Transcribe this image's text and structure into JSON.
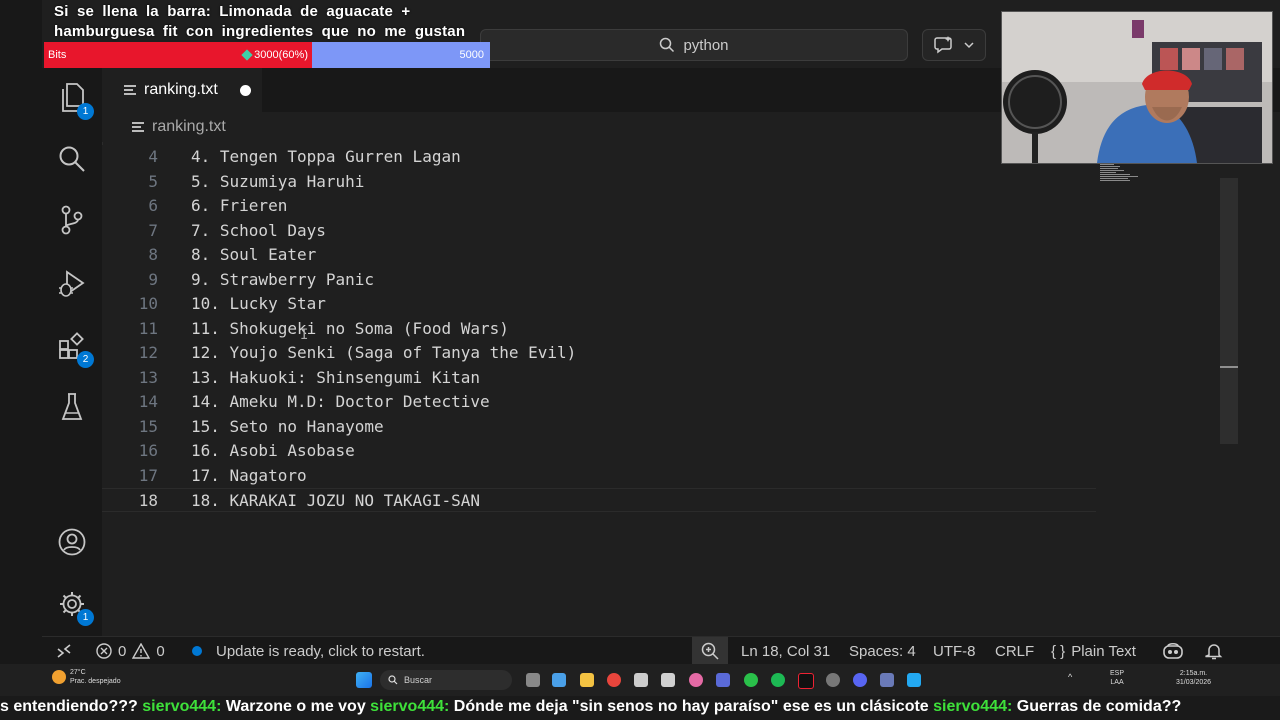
{
  "overlay": {
    "goal_text": "Si se llena la barra: Limonada de aguacate + hamburguesa fit con ingredientes que no me gustan",
    "bits_label": "Bits",
    "bits_progress_label": "3000(60%)",
    "bits_goal": "5000",
    "bits_fraction": 0.6
  },
  "titlebar": {
    "search_text": "python"
  },
  "activity_bar": {
    "explorer_badge": "1",
    "extensions_badge": "2",
    "settings_badge": "1"
  },
  "tab": {
    "label": "ranking.txt"
  },
  "breadcrumb": {
    "file": "ranking.txt"
  },
  "editor": {
    "lines": [
      {
        "num": "4",
        "text": "4. Tengen Toppa Gurren Lagan"
      },
      {
        "num": "5",
        "text": "5. Suzumiya Haruhi"
      },
      {
        "num": "6",
        "text": "6. Frieren"
      },
      {
        "num": "7",
        "text": "7. School Days"
      },
      {
        "num": "8",
        "text": "8. Soul Eater"
      },
      {
        "num": "9",
        "text": "9. Strawberry Panic"
      },
      {
        "num": "10",
        "text": "10. Lucky Star"
      },
      {
        "num": "11",
        "text": "11. Shokugeki no Soma (Food Wars)"
      },
      {
        "num": "12",
        "text": "12. Youjo Senki (Saga of Tanya the Evil)"
      },
      {
        "num": "13",
        "text": "13. Hakuoki: Shinsengumi Kitan"
      },
      {
        "num": "14",
        "text": "14. Ameku M.D: Doctor Detective"
      },
      {
        "num": "15",
        "text": "15. Seto no Hanayome"
      },
      {
        "num": "16",
        "text": "16. Asobi Asobase"
      },
      {
        "num": "17",
        "text": "17. Nagatoro"
      },
      {
        "num": "18",
        "text": "18. KARAKAI JOZU NO TAKAGI-SAN"
      }
    ]
  },
  "statusbar": {
    "errors": "0",
    "warnings": "0",
    "update_msg": "Update is ready, click to restart.",
    "cursor_pos": "Ln 18, Col 31",
    "spaces": "Spaces: 4",
    "encoding": "UTF-8",
    "eol": "CRLF",
    "language": "Plain Text"
  },
  "taskbar": {
    "temp": "27°C",
    "weather_desc": "Prac. despejado",
    "search_label": "Buscar",
    "lang_top": "ESP",
    "lang_bottom": "LAA",
    "time": "2:15a.m.",
    "date": "31/03/2026"
  },
  "chat": {
    "messages": [
      {
        "user": "",
        "text": "s entendiendo???"
      },
      {
        "user": "siervo444:",
        "text": "Warzone o me voy"
      },
      {
        "user": "siervo444:",
        "text": "Dónde me deja \"sin senos no hay paraíso\" ese es un clásicote"
      },
      {
        "user": "siervo444:",
        "text": "Guerras de comida??"
      }
    ]
  },
  "colors": {
    "accent": "#0078d4",
    "bits_red": "#e8162c",
    "bits_blue": "#7d97f7",
    "chat_user": "#3ee03a"
  }
}
